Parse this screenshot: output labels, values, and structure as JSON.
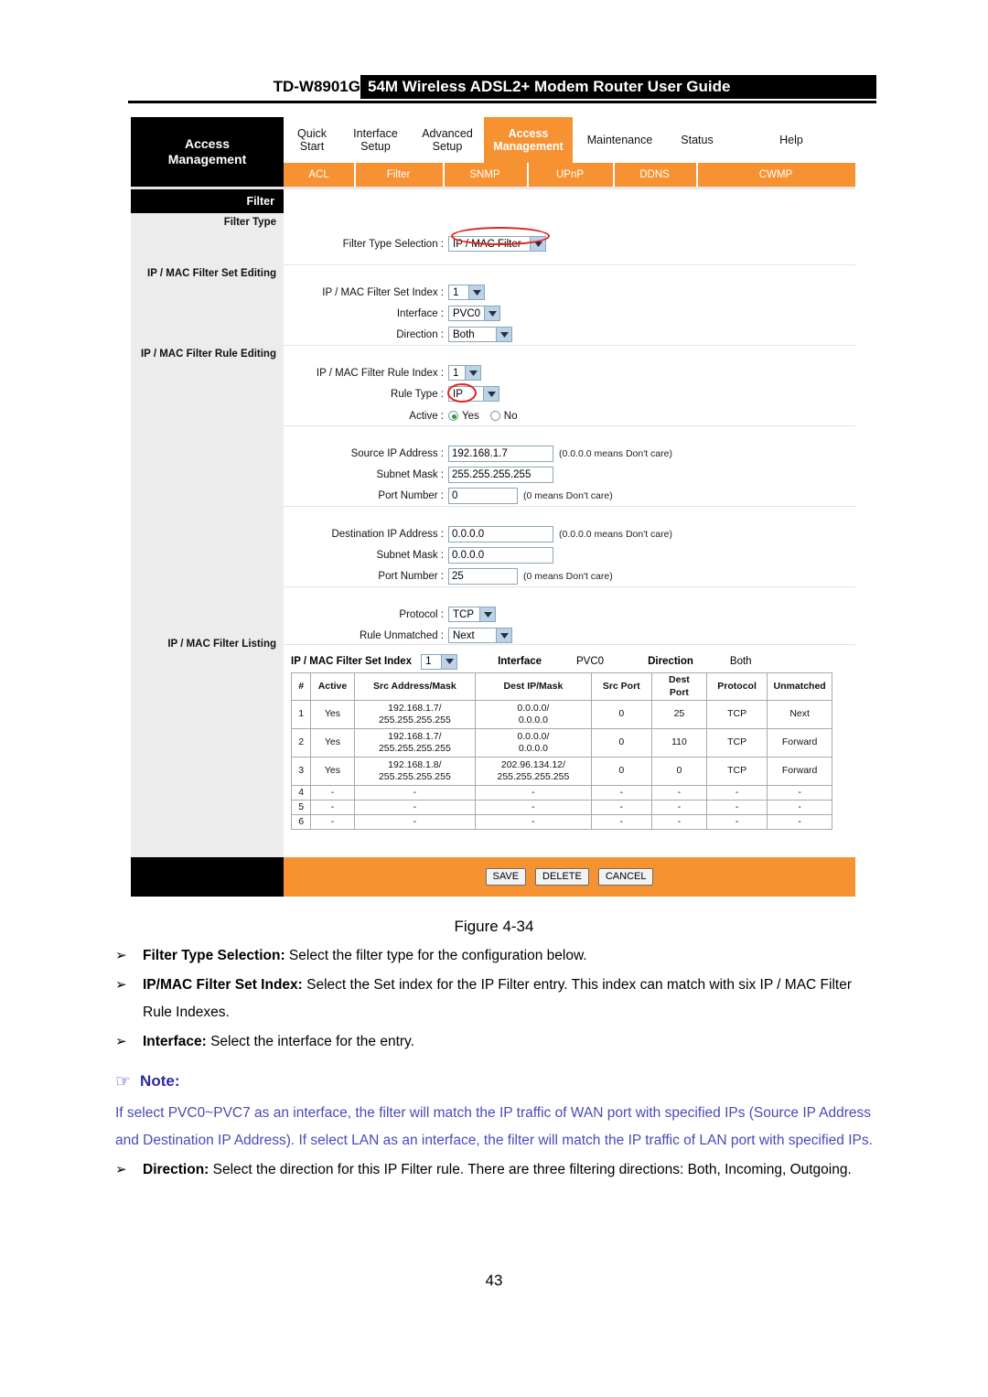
{
  "doc": {
    "model": "TD-W8901G",
    "header_title": "54M Wireless ADSL2+ Modem Router User Guide",
    "figure_caption": "Figure 4-34",
    "page_number": "43"
  },
  "router_ui": {
    "brand_line1": "Access",
    "brand_line2": "Management",
    "main_tabs": [
      {
        "label": "Quick\nStart",
        "active": false
      },
      {
        "label": "Interface\nSetup",
        "active": false
      },
      {
        "label": "Advanced\nSetup",
        "active": false
      },
      {
        "label": "Access\nManagement",
        "active": true
      },
      {
        "label": "Maintenance",
        "active": false
      },
      {
        "label": "Status",
        "active": false
      },
      {
        "label": "Help",
        "active": false
      }
    ],
    "sub_tabs": [
      {
        "label": "ACL",
        "highlighted": false
      },
      {
        "label": "Filter",
        "highlighted": true
      },
      {
        "label": "SNMP",
        "highlighted": false
      },
      {
        "label": "UPnP",
        "highlighted": false
      },
      {
        "label": "DDNS",
        "highlighted": false
      },
      {
        "label": "CWMP",
        "highlighted": false
      }
    ],
    "panel_title": "Filter",
    "side_sections": [
      "Filter Type",
      "IP / MAC Filter Set Editing",
      "IP / MAC Filter Rule Editing",
      "IP / MAC Filter Listing"
    ],
    "filter_type": {
      "label": "Filter Type Selection :",
      "value": "IP / MAC Filter"
    },
    "set_editing": {
      "set_index_label": "IP / MAC Filter Set Index :",
      "set_index_value": "1",
      "interface_label": "Interface :",
      "interface_value": "PVC0",
      "direction_label": "Direction :",
      "direction_value": "Both"
    },
    "rule_editing": {
      "rule_index_label": "IP / MAC Filter Rule Index :",
      "rule_index_value": "1",
      "rule_type_label": "Rule Type :",
      "rule_type_value": "IP",
      "active_label": "Active :",
      "active_yes": "Yes",
      "active_no": "No",
      "active_selected": "Yes"
    },
    "source": {
      "ip_label": "Source IP Address :",
      "ip_value": "192.168.1.7",
      "mask_label": "Subnet Mask :",
      "mask_value": "255.255.255.255",
      "port_label": "Port Number :",
      "port_value": "0",
      "ip_hint": "(0.0.0.0 means Don't care)",
      "port_hint": "(0 means Don't care)"
    },
    "destination": {
      "ip_label": "Destination IP Address :",
      "ip_value": "0.0.0.0",
      "mask_label": "Subnet Mask :",
      "mask_value": "0.0.0.0",
      "port_label": "Port Number :",
      "port_value": "25",
      "ip_hint": "(0.0.0.0 means Don't care)",
      "port_hint": "(0 means Don't care)"
    },
    "protocol_block": {
      "protocol_label": "Protocol :",
      "protocol_value": "TCP",
      "unmatched_label": "Rule Unmatched :",
      "unmatched_value": "Next"
    },
    "listing": {
      "set_index_label": "IP / MAC Filter Set Index",
      "set_index_value": "1",
      "interface_label": "Interface",
      "interface_value": "PVC0",
      "direction_label": "Direction",
      "direction_value": "Both",
      "columns": [
        "#",
        "Active",
        "Src Address/Mask",
        "Dest IP/Mask",
        "Src Port",
        "Dest\nPort",
        "Protocol",
        "Unmatched"
      ],
      "rows": [
        {
          "num": "1",
          "active": "Yes",
          "src": "192.168.1.7/\n255.255.255.255",
          "dest": "0.0.0.0/\n0.0.0.0",
          "srcport": "0",
          "destport": "25",
          "protocol": "TCP",
          "unmatched": "Next"
        },
        {
          "num": "2",
          "active": "Yes",
          "src": "192.168.1.7/\n255.255.255.255",
          "dest": "0.0.0.0/\n0.0.0.0",
          "srcport": "0",
          "destport": "110",
          "protocol": "TCP",
          "unmatched": "Forward"
        },
        {
          "num": "3",
          "active": "Yes",
          "src": "192.168.1.8/\n255.255.255.255",
          "dest": "202.96.134.12/\n255.255.255.255",
          "srcport": "0",
          "destport": "0",
          "protocol": "TCP",
          "unmatched": "Forward"
        },
        {
          "num": "4",
          "active": "-",
          "src": "-",
          "dest": "-",
          "srcport": "-",
          "destport": "-",
          "protocol": "-",
          "unmatched": "-"
        },
        {
          "num": "5",
          "active": "-",
          "src": "-",
          "dest": "-",
          "srcport": "-",
          "destport": "-",
          "protocol": "-",
          "unmatched": "-"
        },
        {
          "num": "6",
          "active": "-",
          "src": "-",
          "dest": "-",
          "srcport": "-",
          "destport": "-",
          "protocol": "-",
          "unmatched": "-"
        }
      ]
    },
    "buttons": {
      "save": "SAVE",
      "delete": "DELETE",
      "cancel": "CANCEL"
    },
    "accent_color": "#F79233"
  },
  "content": {
    "bullets": [
      {
        "marker": "➢",
        "bold": "Filter Type Selection:",
        "text": " Select the filter type for the configuration below."
      },
      {
        "marker": "➢",
        "bold": "IP/MAC Filter Set Index:",
        "text": " Select the Set index for the IP Filter entry. This index can match with six IP / MAC Filter Rule Indexes."
      },
      {
        "marker": "➢",
        "bold": "Interface:",
        "text": " Select the interface for the entry."
      }
    ],
    "note": {
      "icon": "☞",
      "title": "Note:",
      "paragraph": "If select PVC0~PVC7 as an interface, the filter will match the IP traffic of WAN port with specified IPs (Source IP Address and Destination IP Address). If select LAN as an interface, the filter will match the IP traffic of LAN port with specified IPs.",
      "color": "#4a4ab8"
    },
    "bullet_after_note": {
      "marker": "➢",
      "bold": "Direction:",
      "text": " Select the direction for this IP Filter rule. There are three filtering directions: Both, Incoming, Outgoing."
    }
  }
}
